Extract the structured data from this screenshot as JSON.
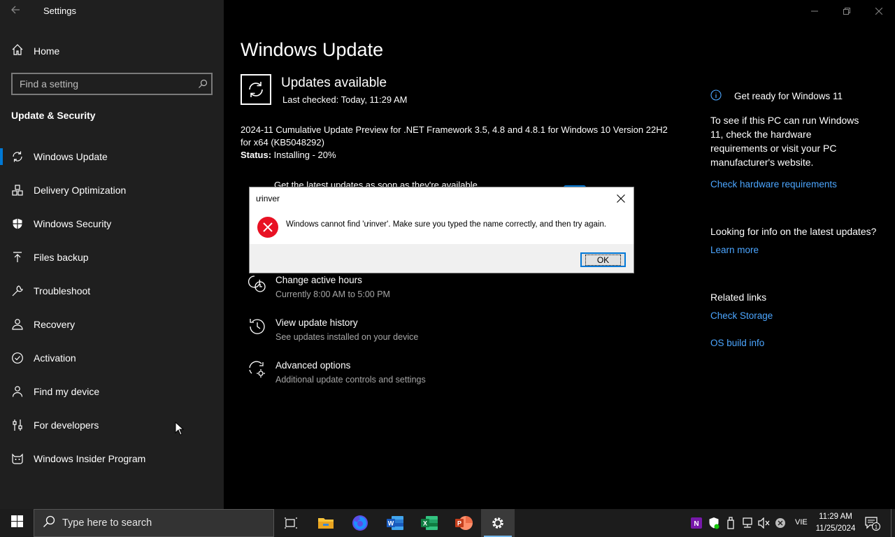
{
  "app": {
    "title": "Settings"
  },
  "sidebar": {
    "home_label": "Home",
    "search_placeholder": "Find a setting",
    "section_title": "Update & Security",
    "items": [
      {
        "label": "Windows Update",
        "icon": "sync-icon",
        "active": true
      },
      {
        "label": "Delivery Optimization",
        "icon": "delivery-icon"
      },
      {
        "label": "Windows Security",
        "icon": "shield-icon"
      },
      {
        "label": "Files backup",
        "icon": "backup-arrow-icon"
      },
      {
        "label": "Troubleshoot",
        "icon": "wrench-icon"
      },
      {
        "label": "Recovery",
        "icon": "recovery-icon"
      },
      {
        "label": "Activation",
        "icon": "check-circle-icon"
      },
      {
        "label": "Find my device",
        "icon": "person-locate-icon"
      },
      {
        "label": "For developers",
        "icon": "developer-sliders-icon"
      },
      {
        "label": "Windows Insider Program",
        "icon": "insider-cat-icon"
      }
    ]
  },
  "main": {
    "title": "Windows Update",
    "status_title": "Updates available",
    "last_checked": "Last checked: Today, 11:29 AM",
    "update_desc": "2024-11 Cumulative Update Preview for .NET Framework 3.5, 4.8 and 4.8.1 for Windows 10 Version 22H2 for x64 (KB5048292)",
    "status_label": "Status:",
    "status_value": " Installing - 20%",
    "partial_row": "Get the latest updates as soon as they're available",
    "options": [
      {
        "title": "Change active hours",
        "sub": "Currently 8:00 AM to 5:00 PM",
        "icon": "clock-icon"
      },
      {
        "title": "View update history",
        "sub": "See updates installed on your device",
        "icon": "history-icon"
      },
      {
        "title": "Advanced options",
        "sub": "Additional update controls and settings",
        "icon": "advanced-sync-gear-icon"
      }
    ]
  },
  "right": {
    "win11_head": "Get ready for Windows 11",
    "win11_text": "To see if this PC can run Windows 11, check the hardware requirements or visit your PC manufacturer's website.",
    "win11_link": "Check hardware requirements",
    "info_head": "Looking for info on the latest updates?",
    "info_link": "Learn more",
    "related_head": "Related links",
    "related_links": [
      "Check Storage",
      "OS build info"
    ]
  },
  "dialog": {
    "title": "ưinver",
    "message": "Windows cannot find 'ưinver'. Make sure you typed the name correctly, and then try again.",
    "ok_label": "OK"
  },
  "taskbar": {
    "search_placeholder": "Type here to search",
    "apps": [
      "task-view-icon",
      "file-explorer-icon",
      "firefox-icon",
      "word-icon",
      "excel-icon",
      "powerpoint-icon",
      "settings-gear-icon"
    ],
    "language": "VIE",
    "time": "11:29 AM",
    "date": "11/25/2024",
    "notification_count": "1"
  },
  "colors": {
    "accent": "#0078d4",
    "link": "#4ca6ff",
    "sidebar_bg": "#1f1f1f",
    "error_red": "#e81123"
  }
}
